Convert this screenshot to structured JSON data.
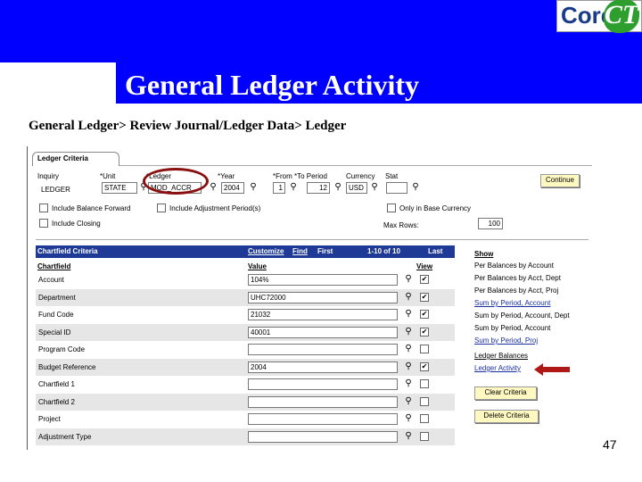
{
  "slide": {
    "title": "General Ledger Activity",
    "breadcrumb": "General Ledger> Review Journal/Ledger Data> Ledger",
    "page_number": "47",
    "logo_text": "Core-",
    "logo_mark": "CT"
  },
  "tab": {
    "label": "Ledger Criteria"
  },
  "criteria": {
    "labels": {
      "inquiry": "Inquiry",
      "unit": "*Unit",
      "ledger": "*Ledger",
      "year": "*Year",
      "from_to_period": "*From *To Period",
      "currency": "Currency",
      "stat": "Stat"
    },
    "inquiry_value": "LEDGER",
    "unit_value": "STATE",
    "ledger_value": "MOD_ACCR",
    "year_value": "2004",
    "from_period": "1",
    "to_period": "12",
    "currency_value": "USD",
    "stat_value": "",
    "include_balance_forward": "Include Balance Forward",
    "include_adjustment_periods": "Include Adjustment Period(s)",
    "include_closing": "Include Closing",
    "only_in_base_currency": "Only in Base Currency",
    "max_rows_label": "Max Rows:",
    "max_rows_value": "100",
    "continue_label": "Continue"
  },
  "chartfield": {
    "title": "Chartfield Criteria",
    "customize": "Customize",
    "find": "Find",
    "first": "First",
    "range": "1-10 of 10",
    "last": "Last",
    "col_chartfield": "Chartfield",
    "col_value": "Value",
    "col_view": "View",
    "rows": [
      {
        "name": "Account",
        "value": "104%",
        "view": true
      },
      {
        "name": "Department",
        "value": "UHC72000",
        "view": true
      },
      {
        "name": "Fund Code",
        "value": "21032",
        "view": true
      },
      {
        "name": "Special ID",
        "value": "40001",
        "view": true
      },
      {
        "name": "Program Code",
        "value": "",
        "view": false
      },
      {
        "name": "Budget Reference",
        "value": "2004",
        "view": true
      },
      {
        "name": "Chartfield 1",
        "value": "",
        "view": false
      },
      {
        "name": "Chartfield 2",
        "value": "",
        "view": false
      },
      {
        "name": "Project",
        "value": "",
        "view": false
      },
      {
        "name": "Adjustment Type",
        "value": "",
        "view": false
      }
    ]
  },
  "show": {
    "title": "Show",
    "items": [
      {
        "label": "Per Balances by Account",
        "link": false
      },
      {
        "label": "Per Balances by Acct, Dept",
        "link": false
      },
      {
        "label": "Per Balances by Acct, Proj",
        "link": false
      },
      {
        "label": "Sum by Period, Account",
        "link": true
      },
      {
        "label": "Sum by Period, Account, Dept",
        "link": false
      },
      {
        "label": "Sum by Period, Account",
        "link": false
      },
      {
        "label": "Sum by Period, Proj",
        "link": true
      }
    ],
    "ledger_balances": "Ledger Balances",
    "ledger_activity": "Ledger Activity",
    "clear_criteria": "Clear Criteria",
    "delete_criteria": "Delete Criteria"
  },
  "colors": {
    "band": "#0000ff",
    "grid_header": "#1e3a96",
    "button": "#fff8c0",
    "highlight": "#8a1010"
  }
}
